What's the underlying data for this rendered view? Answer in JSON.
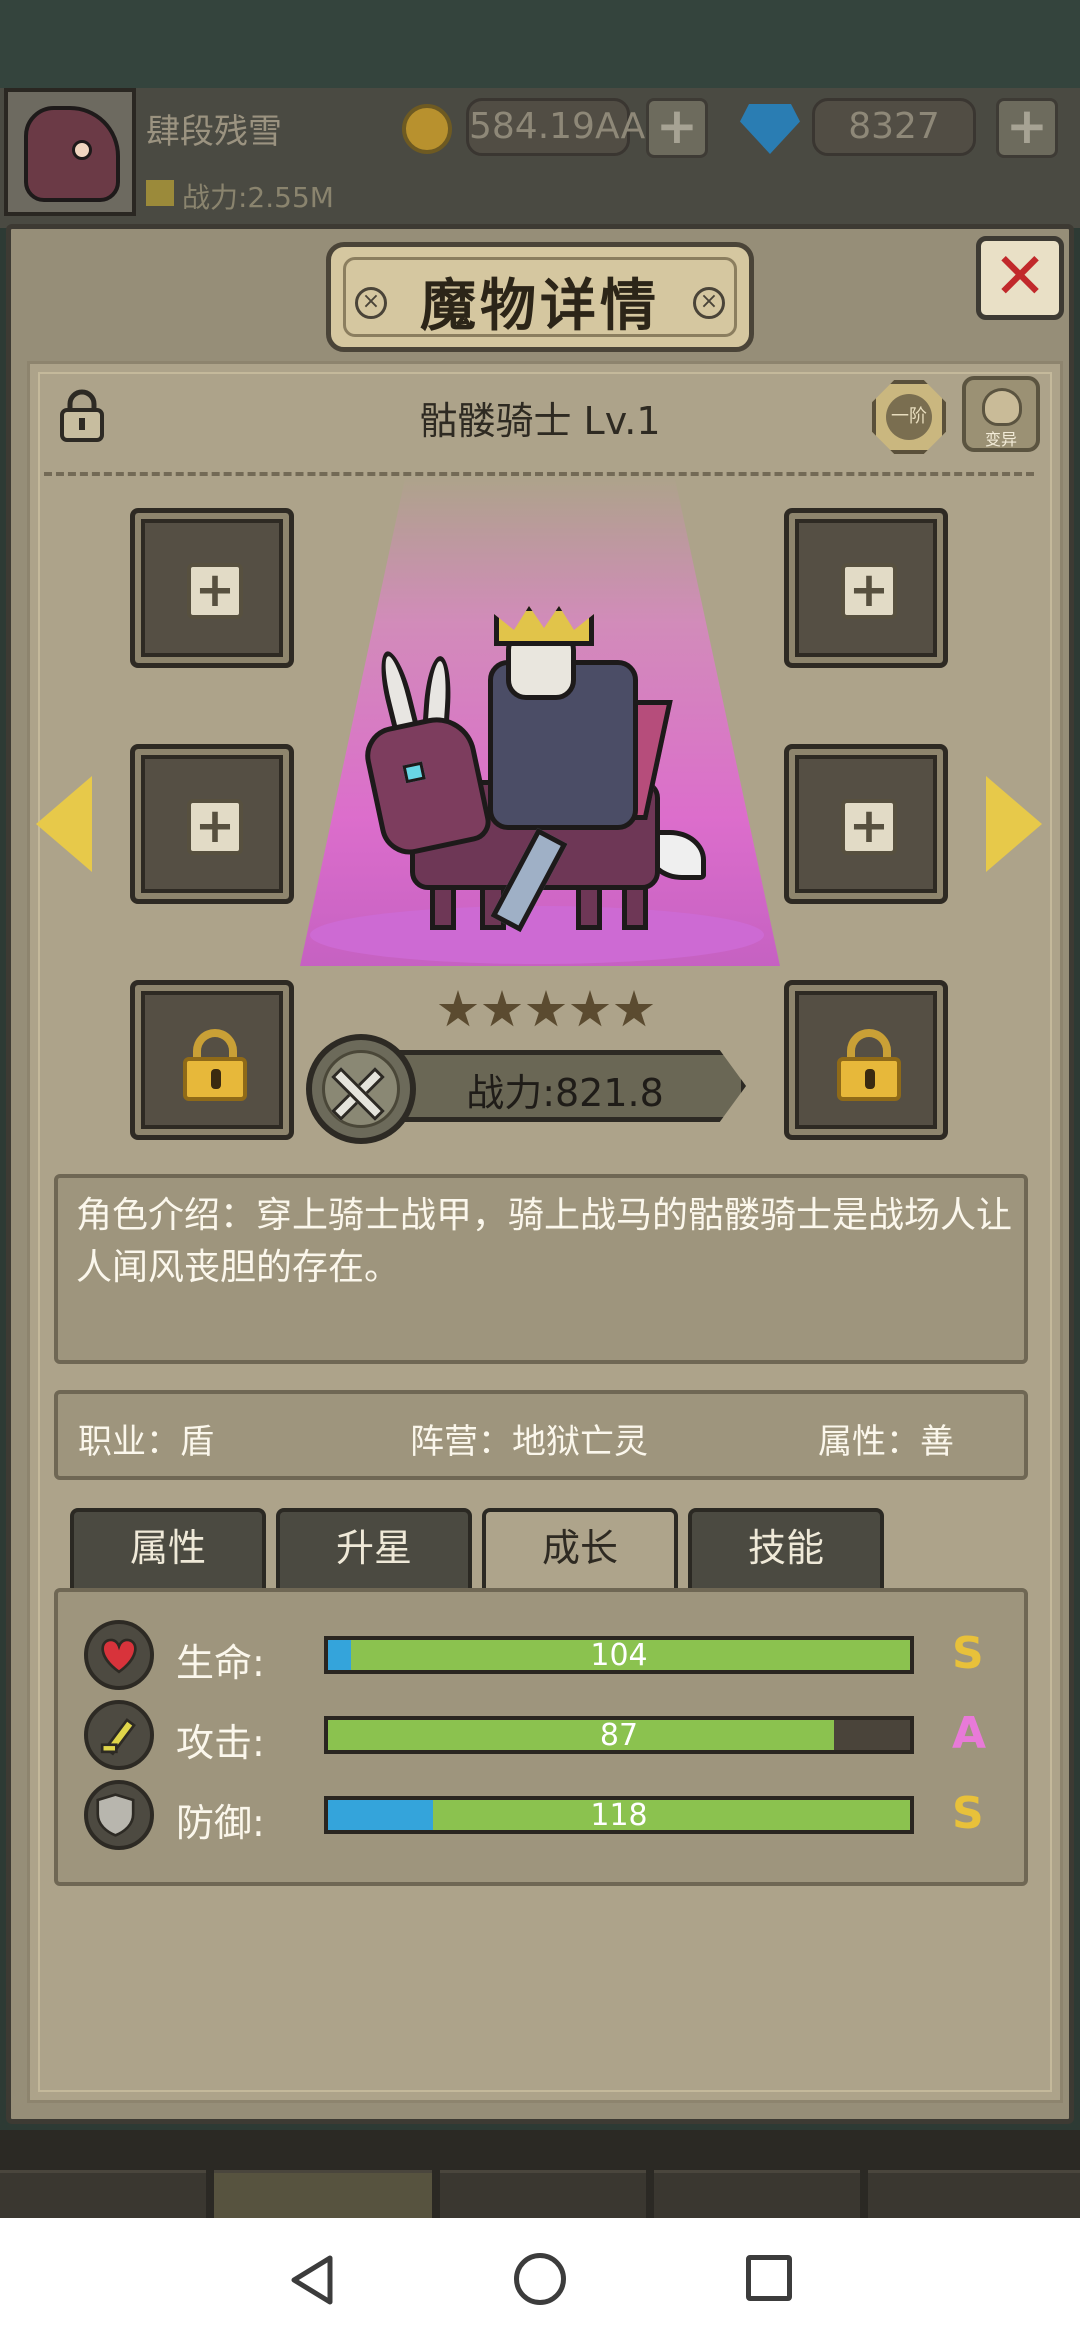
{
  "header": {
    "player_name": "肆段残雪",
    "player_power": "战力:2.55M",
    "gold": "584.19AA",
    "gems": "8327",
    "plus_label": "+"
  },
  "dialog": {
    "title": "魔物详情",
    "close_label": "✕",
    "monster_name": "骷髅骑士 Lv.1",
    "grade_label": "一阶",
    "mutate_label": "变异",
    "plus_label": "+",
    "stars": 5,
    "power_label": "战力:821.8",
    "description": "角色介绍：穿上骑士战甲，骑上战马的骷髅骑士是战场人让人闻风丧胆的存在。",
    "info": {
      "job": "职业：盾",
      "faction": "阵营：地狱亡灵",
      "alignment": "属性：善"
    },
    "tabs": [
      {
        "label": "属性",
        "active": false
      },
      {
        "label": "升星",
        "active": false
      },
      {
        "label": "成长",
        "active": true
      },
      {
        "label": "技能",
        "active": false
      }
    ],
    "stats": [
      {
        "label": "生命:",
        "value": "104",
        "grade": "S",
        "grade_color": "#e8c13a",
        "blue_fraction": 0.04,
        "fill_fraction": 1.0,
        "icon": "heart-icon"
      },
      {
        "label": "攻击:",
        "value": "87",
        "grade": "A",
        "grade_color": "#e87ad8",
        "blue_fraction": 0.0,
        "fill_fraction": 0.87,
        "icon": "sword-icon"
      },
      {
        "label": "防御:",
        "value": "118",
        "grade": "S",
        "grade_color": "#e8c13a",
        "blue_fraction": 0.18,
        "fill_fraction": 1.0,
        "icon": "shield-icon"
      }
    ]
  },
  "colors": {
    "spotlight": "#e67ad9",
    "bar_green": "#8bc24f",
    "bar_blue": "#34a4db",
    "close_red": "#c1292b"
  }
}
